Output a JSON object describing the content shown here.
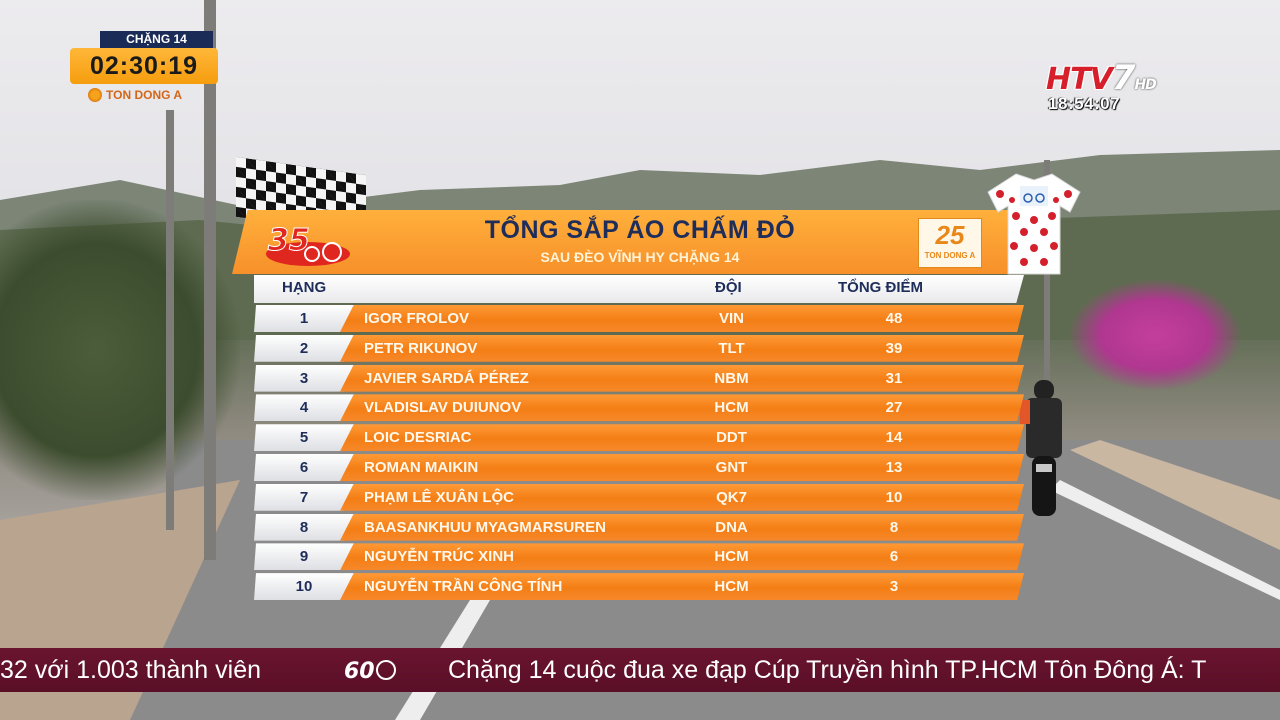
{
  "timer": {
    "stage": "CHẶNG 14",
    "time": "02:30:19",
    "sponsor": "TON DONG A"
  },
  "channel": {
    "logo": "HTV",
    "number": "7",
    "hd": "HD",
    "clock": "18:54:07"
  },
  "panel": {
    "title": "TỔNG SẮP ÁO CHẤM ĐỎ",
    "subtitle": "SAU ĐÈO VĨNH HY CHẶNG 14",
    "logo_left": "35",
    "sponsor_number": "25",
    "sponsor_text": "TON DONG A",
    "columns": {
      "rank": "HẠNG",
      "team": "ĐỘI",
      "points": "TỔNG ĐIỂM"
    },
    "rows": [
      {
        "rank": "1",
        "name": "IGOR FROLOV",
        "team": "VIN",
        "points": "48"
      },
      {
        "rank": "2",
        "name": "PETR RIKUNOV",
        "team": "TLT",
        "points": "39"
      },
      {
        "rank": "3",
        "name": "JAVIER SARDÁ PÉREZ",
        "team": "NBM",
        "points": "31"
      },
      {
        "rank": "4",
        "name": "VLADISLAV DUIUNOV",
        "team": "HCM",
        "points": "27"
      },
      {
        "rank": "5",
        "name": "LOIC DESRIAC",
        "team": "DDT",
        "points": "14"
      },
      {
        "rank": "6",
        "name": "ROMAN MAIKIN",
        "team": "GNT",
        "points": "13"
      },
      {
        "rank": "7",
        "name": "PHẠM LÊ XUÂN LỘC",
        "team": "QK7",
        "points": "10"
      },
      {
        "rank": "8",
        "name": "BAASANKHUU MYAGMARSUREN",
        "team": "DNA",
        "points": "8"
      },
      {
        "rank": "9",
        "name": "NGUYỄN TRÚC XINH",
        "team": "HCM",
        "points": "6"
      },
      {
        "rank": "10",
        "name": "NGUYỄN TRẦN CÔNG TÍNH",
        "team": "HCM",
        "points": "3"
      }
    ]
  },
  "ticker": {
    "left_text": "32 với 1.003 thành viên",
    "logo": "60",
    "right_text": "Chặng 14 cuộc đua xe đạp Cúp Truyền hình TP.HCM  Tôn Đông Á: T"
  },
  "colors": {
    "orange": "#f47e15",
    "navy": "#1e2d5a",
    "ticker": "#5a0f27",
    "red": "#d61f2a"
  }
}
